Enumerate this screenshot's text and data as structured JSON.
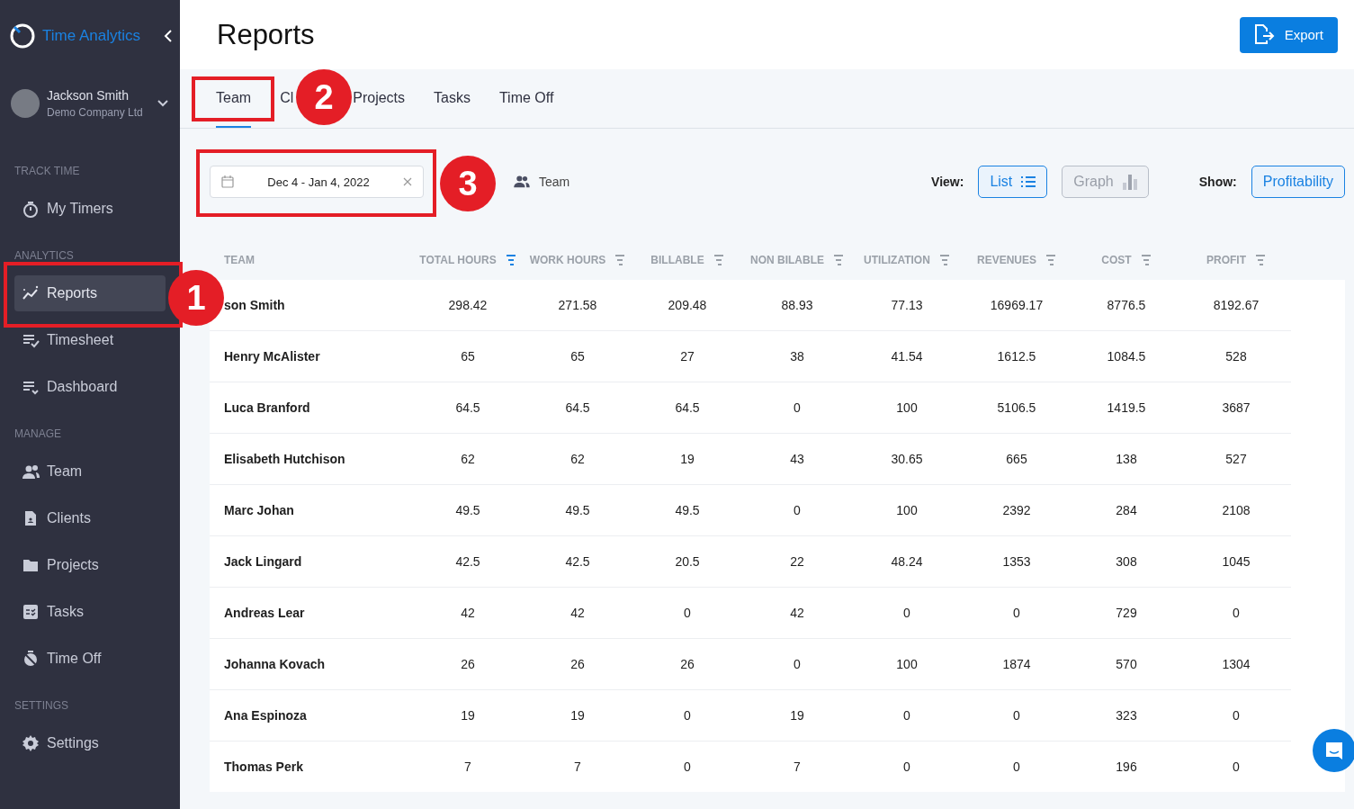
{
  "sidebar": {
    "app_name": "Time Analytics",
    "user": {
      "name": "Jackson Smith",
      "company": "Demo Company Ltd"
    },
    "sections": [
      {
        "title": "TRACK TIME",
        "items": [
          {
            "label": "My Timers",
            "selected": false
          }
        ]
      },
      {
        "title": "ANALYTICS",
        "items": [
          {
            "label": "Reports",
            "selected": true
          },
          {
            "label": "Timesheet",
            "selected": false
          },
          {
            "label": "Dashboard",
            "selected": false
          }
        ]
      },
      {
        "title": "MANAGE",
        "items": [
          {
            "label": "Team",
            "selected": false
          },
          {
            "label": "Clients",
            "selected": false
          },
          {
            "label": "Projects",
            "selected": false
          },
          {
            "label": "Tasks",
            "selected": false
          },
          {
            "label": "Time Off",
            "selected": false
          }
        ]
      },
      {
        "title": "SETTINGS",
        "items": [
          {
            "label": "Settings",
            "selected": false
          }
        ]
      }
    ]
  },
  "header": {
    "title": "Reports",
    "export_button": "Export"
  },
  "tabs": [
    {
      "label": "Team",
      "selected": true
    },
    {
      "label": "Cl",
      "selected": false
    },
    {
      "label": "Projects",
      "selected": false
    },
    {
      "label": "Tasks",
      "selected": false
    },
    {
      "label": "Time Off",
      "selected": false
    }
  ],
  "filters": {
    "date_range": "Dec 4 - Jan 4, 2022",
    "group": "Team",
    "view_label": "View:",
    "views": [
      {
        "label": "List",
        "selected": true
      },
      {
        "label": "Graph",
        "selected": false
      }
    ],
    "show_label": "Show:",
    "show": {
      "label": "Profitability",
      "selected": true
    }
  },
  "table": {
    "columns": [
      {
        "label": "TEAM"
      },
      {
        "label": "TOTAL HOURS",
        "sorted": true
      },
      {
        "label": "WORK HOURS",
        "sorted": false
      },
      {
        "label": "BILLABLE",
        "sorted": false
      },
      {
        "label": "NON BILABLE",
        "sorted": false
      },
      {
        "label": "UTILIZATION",
        "sorted": false
      },
      {
        "label": "REVENUES",
        "sorted": false
      },
      {
        "label": "COST",
        "sorted": false
      },
      {
        "label": "PROFIT",
        "sorted": false
      }
    ],
    "rows": [
      [
        "son Smith",
        "298.42",
        "271.58",
        "209.48",
        "88.93",
        "77.13",
        "16969.17",
        "8776.5",
        "8192.67"
      ],
      [
        "Henry McAlister",
        "65",
        "65",
        "27",
        "38",
        "41.54",
        "1612.5",
        "1084.5",
        "528"
      ],
      [
        "Luca Branford",
        "64.5",
        "64.5",
        "64.5",
        "0",
        "100",
        "5106.5",
        "1419.5",
        "3687"
      ],
      [
        "Elisabeth Hutchison",
        "62",
        "62",
        "19",
        "43",
        "30.65",
        "665",
        "138",
        "527"
      ],
      [
        "Marc Johan",
        "49.5",
        "49.5",
        "49.5",
        "0",
        "100",
        "2392",
        "284",
        "2108"
      ],
      [
        "Jack Lingard",
        "42.5",
        "42.5",
        "20.5",
        "22",
        "48.24",
        "1353",
        "308",
        "1045"
      ],
      [
        "Andreas Lear",
        "42",
        "42",
        "0",
        "42",
        "0",
        "0",
        "729",
        "0"
      ],
      [
        "Johanna Kovach",
        "26",
        "26",
        "26",
        "0",
        "100",
        "1874",
        "570",
        "1304"
      ],
      [
        "Ana Espinoza",
        "19",
        "19",
        "0",
        "19",
        "0",
        "0",
        "323",
        "0"
      ],
      [
        "Thomas Perk",
        "7",
        "7",
        "0",
        "7",
        "0",
        "0",
        "196",
        "0"
      ]
    ]
  },
  "annotations": [
    {
      "label": "1"
    },
    {
      "label": "2"
    },
    {
      "label": "3"
    }
  ]
}
